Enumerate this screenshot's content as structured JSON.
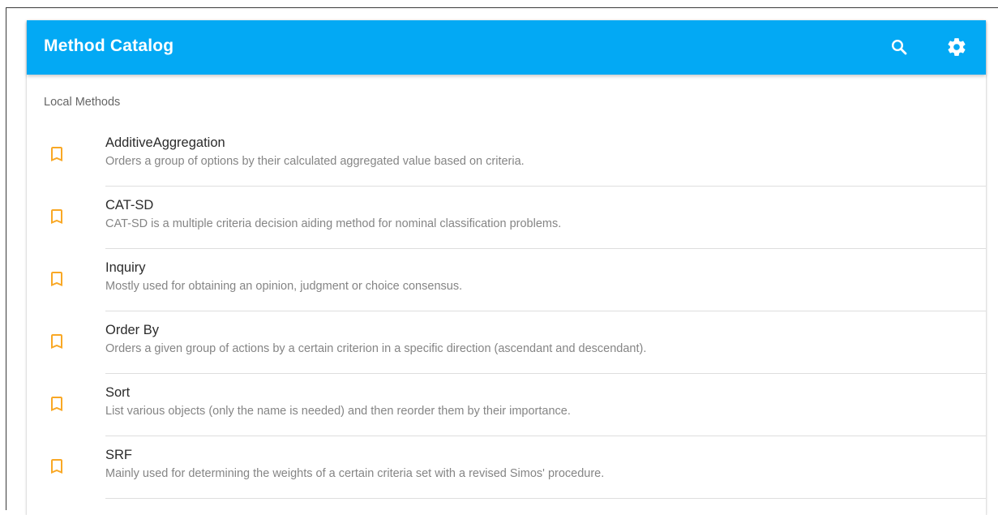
{
  "toolbar": {
    "title": "Method Catalog",
    "background_color": "#03a9f4",
    "actions": [
      {
        "icon": "search-icon"
      },
      {
        "icon": "gear-icon"
      }
    ]
  },
  "list": {
    "subheader": "Local Methods",
    "icon": "bookmark-icon",
    "icon_color": "#f9a825",
    "items": [
      {
        "name": "AdditiveAggregation",
        "description": "Orders a group of options by their calculated aggregated value based on criteria."
      },
      {
        "name": "CAT-SD",
        "description": "CAT-SD is a multiple criteria decision aiding method for nominal classification problems."
      },
      {
        "name": "Inquiry",
        "description": "Mostly used for obtaining an opinion, judgment or choice consensus."
      },
      {
        "name": "Order By",
        "description": "Orders a given group of actions by a certain criterion in a specific direction (ascendant and descendant)."
      },
      {
        "name": "Sort",
        "description": "List various objects (only the name is needed) and then reorder them by their importance."
      },
      {
        "name": "SRF",
        "description": "Mainly used for determining the weights of a certain criteria set with a revised Simos' procedure."
      }
    ]
  }
}
